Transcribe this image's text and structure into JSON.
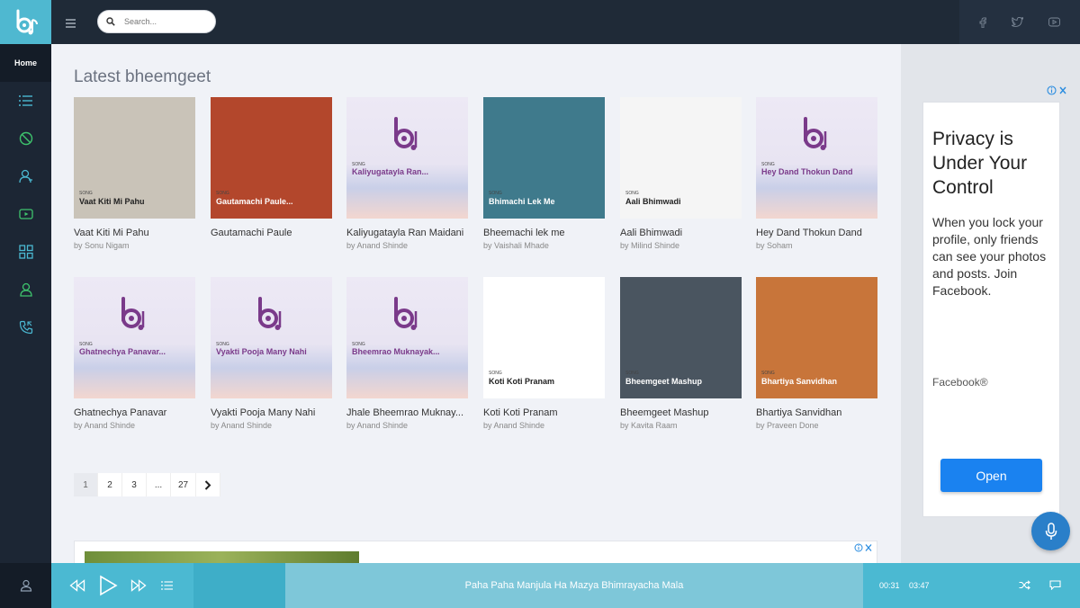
{
  "nav": {
    "home_label": "Home"
  },
  "search": {
    "placeholder": "Search..."
  },
  "section_title": "Latest bheemgeet",
  "songs": [
    {
      "title": "Vaat Kiti Mi Pahu",
      "artist": "by Sonu Nigam",
      "cover_text": "Vaat Kiti Mi Pahu",
      "cover_tag": "SONG",
      "cover_bg": "#c9c3b8"
    },
    {
      "title": "Gautamachi Paule",
      "artist": "",
      "cover_text": "Gautamachi Paule...",
      "cover_tag": "SONG",
      "cover_bg": "#b3472c"
    },
    {
      "title": "Kaliyugatayla Ran Maidani",
      "artist": "by Anand Shinde",
      "cover_text": "Kaliyugatayla Ran...",
      "cover_tag": "SONG",
      "cover_bg": "#e9e6f2"
    },
    {
      "title": "Bheemachi lek me",
      "artist": "by Vaishali Mhade",
      "cover_text": "Bhimachi Lek Me",
      "cover_tag": "SONG",
      "cover_bg": "#3f7a8c"
    },
    {
      "title": "Aali Bhimwadi",
      "artist": "by Milind Shinde",
      "cover_text": "Aali Bhimwadi",
      "cover_tag": "SONG",
      "cover_bg": "#f5f5f5"
    },
    {
      "title": "Hey Dand Thokun Dand",
      "artist": "by Soham",
      "cover_text": "Hey Dand Thokun Dand",
      "cover_tag": "SONG",
      "cover_bg": "#e9e6f2"
    },
    {
      "title": "Ghatnechya Panavar",
      "artist": "by Anand Shinde",
      "cover_text": "Ghatnechya Panavar...",
      "cover_tag": "SONG",
      "cover_bg": "#e9e6f2"
    },
    {
      "title": "Vyakti Pooja Many Nahi",
      "artist": "by Anand Shinde",
      "cover_text": "Vyakti Pooja Many Nahi",
      "cover_tag": "SONG",
      "cover_bg": "#e9e6f2"
    },
    {
      "title": "Jhale Bheemrao Muknay...",
      "artist": "by Anand Shinde",
      "cover_text": "Bheemrao Muknayak...",
      "cover_tag": "SONG",
      "cover_bg": "#e9e6f2"
    },
    {
      "title": "Koti Koti Pranam",
      "artist": "by Anand Shinde",
      "cover_text": "Koti Koti Pranam",
      "cover_tag": "SONG",
      "cover_bg": "#ffffff"
    },
    {
      "title": "Bheemgeet Mashup",
      "artist": "by Kavita Raam",
      "cover_text": "Bheemgeet Mashup",
      "cover_tag": "SONG",
      "cover_bg": "#4a5560"
    },
    {
      "title": "Bhartiya Sanvidhan",
      "artist": "by Praveen Done",
      "cover_text": "Bhartiya Sanvidhan",
      "cover_tag": "SONG",
      "cover_bg": "#c8753a"
    }
  ],
  "pagination": {
    "pages": [
      "1",
      "2",
      "3",
      "...",
      "27"
    ],
    "next": "›",
    "active": "1"
  },
  "ad": {
    "headline": "Privacy is Under Your Control",
    "body": "When you lock your profile, only friends can see your photos and posts. Join Facebook.",
    "brand": "Facebook®",
    "cta": "Open"
  },
  "player": {
    "track": "Paha Paha Manjula Ha Mazya Bhimrayacha Mala",
    "current_time": "00:31",
    "total_time": "03:47"
  },
  "colors": {
    "accent": "#4bb9d2",
    "sidebar": "#1c2634",
    "ad_button": "#1a82f0"
  }
}
